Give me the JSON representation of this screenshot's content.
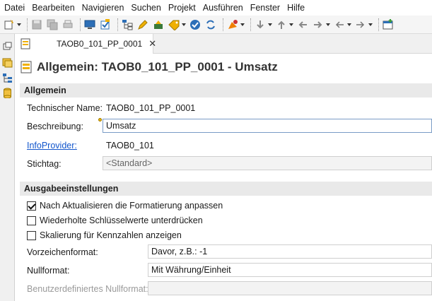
{
  "menu": [
    "Datei",
    "Bearbeiten",
    "Navigieren",
    "Suchen",
    "Projekt",
    "Ausführen",
    "Fenster",
    "Hilfe"
  ],
  "tab": {
    "label": "TAOB0_101_PP_0001",
    "close": "✕"
  },
  "editor": {
    "title": "Allgemein: TAOB0_101_PP_0001 - Umsatz"
  },
  "sections": {
    "general": {
      "header": "Allgemein",
      "tech_name_label": "Technischer Name:",
      "tech_name_value": "TAOB0_101_PP_0001",
      "description_label": "Beschreibung:",
      "description_value": "Umsatz",
      "infoprovider_label": "InfoProvider:",
      "infoprovider_value": "TAOB0_101",
      "keydate_label": "Stichtag:",
      "keydate_value": "<Standard>"
    },
    "output": {
      "header": "Ausgabeeinstellungen",
      "cb1_label": "Nach Aktualisieren die Formatierung anpassen",
      "cb1_checked": true,
      "cb2_label": "Wiederholte Schlüsselwerte unterdrücken",
      "cb2_checked": false,
      "cb3_label": "Skalierung für Kennzahlen anzeigen",
      "cb3_checked": false,
      "sign_label": "Vorzeichenformat:",
      "sign_value": "Davor, z.B.: -1",
      "zero_label": "Nullformat:",
      "zero_value": "Mit Währung/Einheit",
      "custom_zero_label": "Benutzerdefiniertes Nullformat:",
      "custom_zero_value": ""
    }
  },
  "colors": {
    "link": "#1155cc",
    "section_bg": "#e9e9e9",
    "focus_border": "#7a9cc6"
  }
}
